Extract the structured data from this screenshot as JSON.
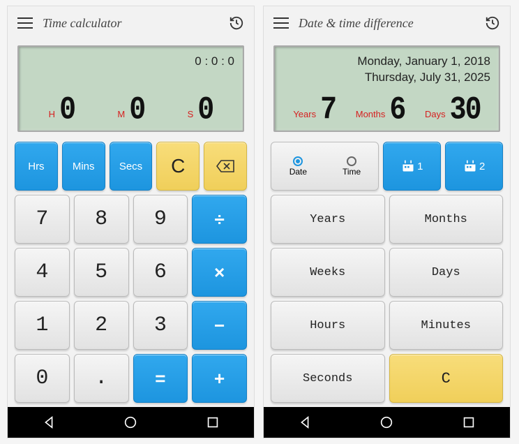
{
  "left": {
    "title": "Time calculator",
    "lcd_top": "0 : 0 : 0",
    "labels": {
      "h": "H",
      "m": "M",
      "s": "S"
    },
    "digits": {
      "h": "0",
      "m": "0",
      "s": "0"
    },
    "unit_buttons": {
      "hrs": "Hrs",
      "mins": "Mins",
      "secs": "Secs"
    },
    "clear": "C",
    "nums": [
      "7",
      "8",
      "9",
      "4",
      "5",
      "6",
      "1",
      "2",
      "3",
      "0",
      ".",
      "="
    ],
    "ops": {
      "div": "÷",
      "mul": "×",
      "sub": "−",
      "add": "+"
    }
  },
  "right": {
    "title": "Date & time difference",
    "date_line1": "Monday, January 1, 2018",
    "date_line2": "Thursday, July 31, 2025",
    "labels": {
      "years": "Years",
      "months": "Months",
      "days": "Days"
    },
    "digits": {
      "years": "7",
      "months": "6",
      "days": "30"
    },
    "segment": {
      "date": "Date",
      "time": "Time"
    },
    "cal": {
      "one": "1",
      "two": "2"
    },
    "buttons": {
      "years": "Years",
      "months": "Months",
      "weeks": "Weeks",
      "days": "Days",
      "hours": "Hours",
      "minutes": "Minutes",
      "seconds": "Seconds",
      "clear": "C"
    }
  }
}
